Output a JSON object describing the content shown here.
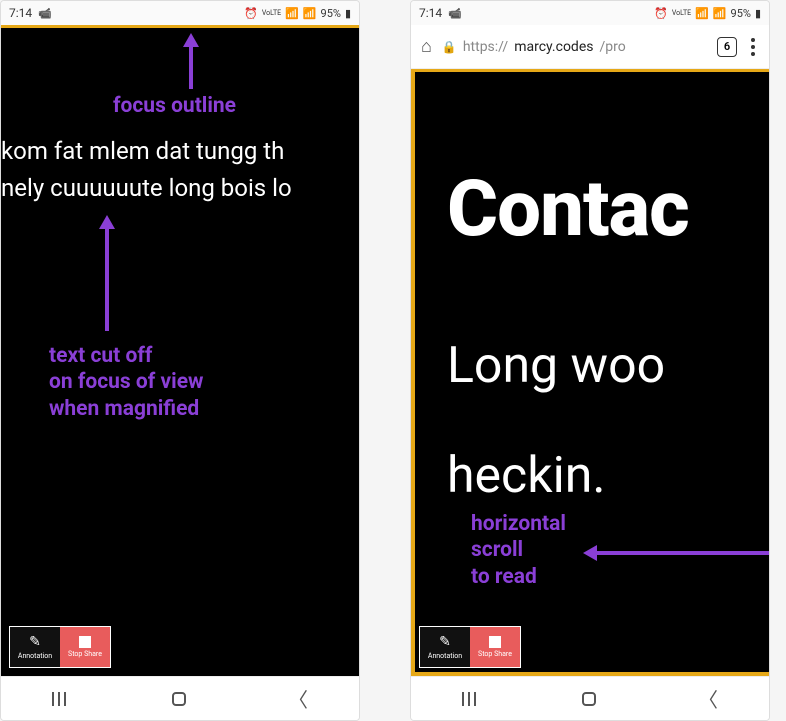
{
  "statusBar": {
    "time": "7:14",
    "battery": "95%",
    "indicators": {
      "volte": "VoLTE",
      "wifi": true,
      "signal": true,
      "alarm": true
    }
  },
  "browser": {
    "urlPrefix": "https://",
    "urlHost": "marcy.codes",
    "urlPath": "/pro",
    "tabCount": "6"
  },
  "left": {
    "textLine1": "kom fat mlem dat tungg th",
    "textLine2": "nely cuuuuuute long bois lo",
    "annotation1": "focus outline",
    "annotation2": "text cut off\non focus of view\nwhen magnified"
  },
  "right": {
    "heading": "Contac",
    "sub1": "Long woo",
    "sub2": "heckin.",
    "annotation": "horizontal\nscroll\nto read"
  },
  "toolbar": {
    "annotateLabel": "Annotation",
    "stopLabel": "Stop Share"
  },
  "colors": {
    "annotation": "#8a3fd6",
    "focusOutline": "#e6a817",
    "stopShare": "#e85c5c"
  }
}
